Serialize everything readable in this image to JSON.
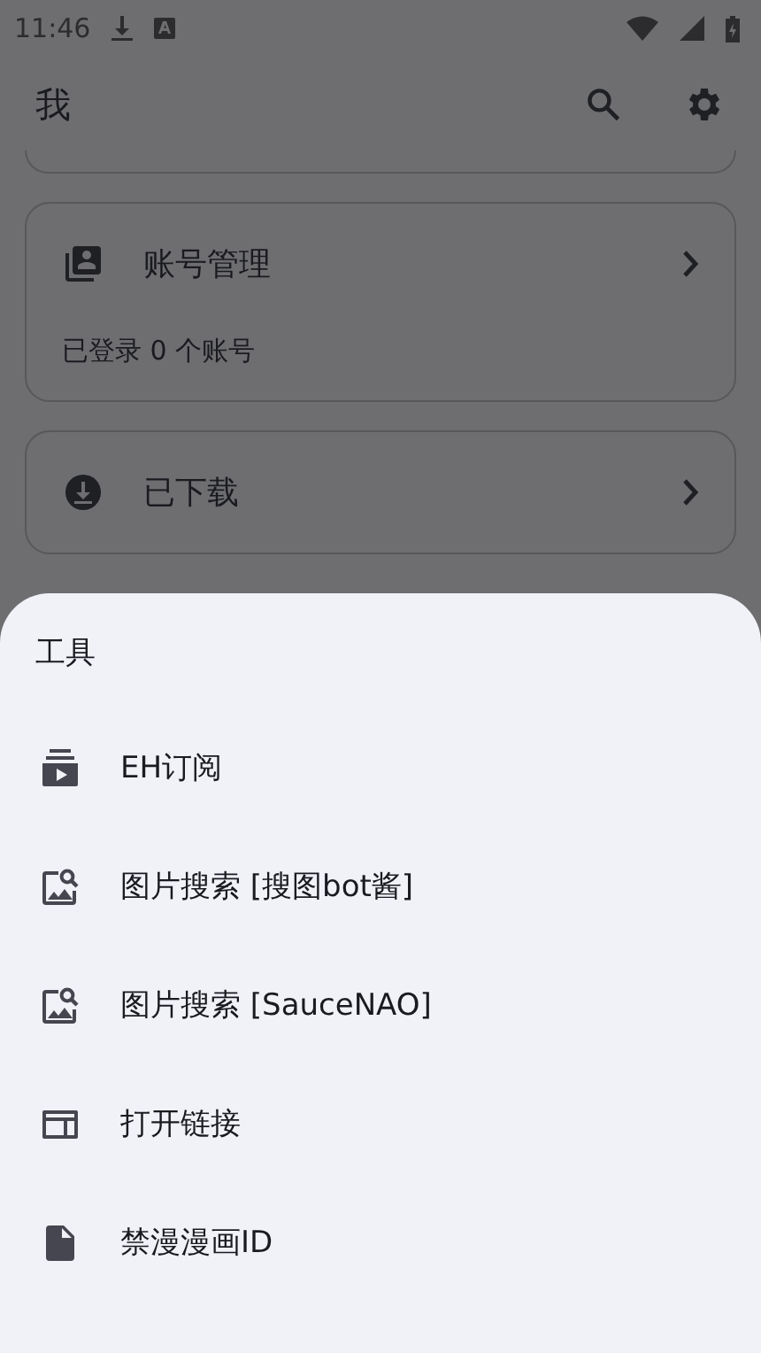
{
  "status_bar": {
    "time": "11:46"
  },
  "app_bar": {
    "title": "我"
  },
  "cards": [
    {
      "kind": "accounts",
      "title": "账号管理",
      "subtitle": "已登录 0 个账号"
    },
    {
      "kind": "downloads",
      "title": "已下载"
    }
  ],
  "sheet": {
    "title": "工具",
    "items": [
      {
        "kind": "subscription",
        "label": "EH订阅"
      },
      {
        "kind": "image-search",
        "label": "图片搜索 [搜图bot酱]"
      },
      {
        "kind": "image-search",
        "label": "图片搜索 [SauceNAO]"
      },
      {
        "kind": "link",
        "label": "打开链接"
      },
      {
        "kind": "file",
        "label": "禁漫漫画ID"
      }
    ]
  }
}
